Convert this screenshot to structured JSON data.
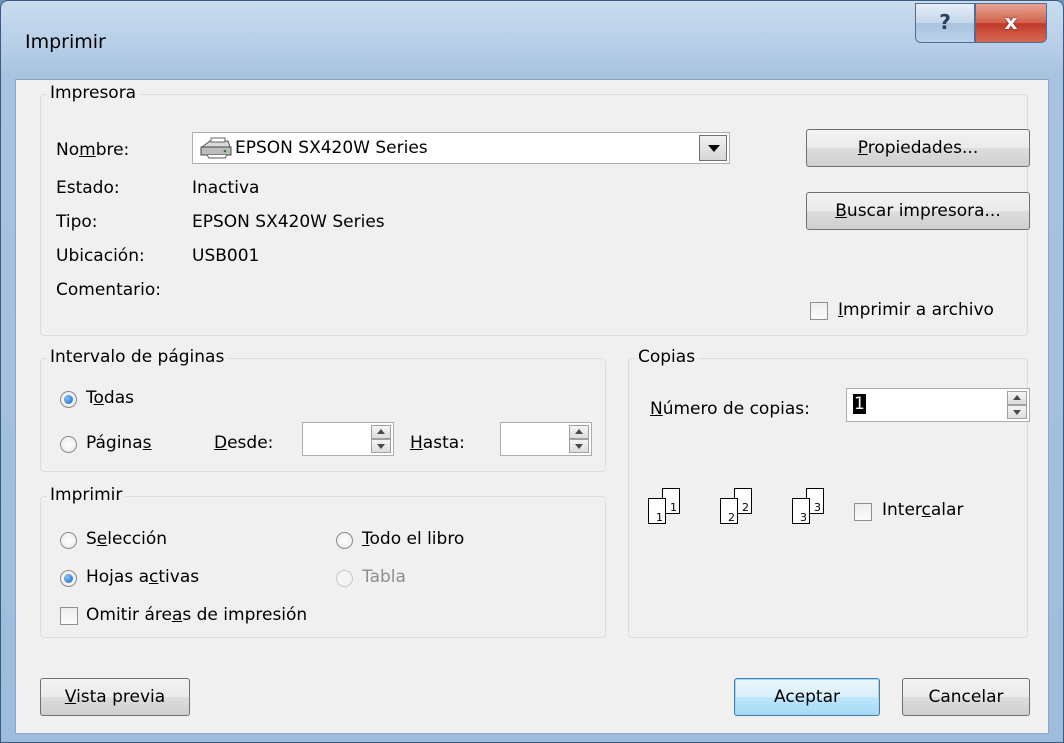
{
  "window": {
    "title": "Imprimir",
    "help_glyph": "?",
    "close_glyph": "x"
  },
  "printer": {
    "group_label": "Impresora",
    "name_label": "Nombre:",
    "name_value": "EPSON SX420W Series",
    "status_label": "Estado:",
    "status_value": "Inactiva",
    "type_label": "Tipo:",
    "type_value": "EPSON SX420W Series",
    "location_label": "Ubicación:",
    "location_value": "USB001",
    "comment_label": "Comentario:",
    "comment_value": "",
    "properties_button": "Propiedades...",
    "find_printer_button": "Buscar impresora...",
    "print_to_file_label": "Imprimir a archivo",
    "print_to_file_checked": false
  },
  "page_range": {
    "group_label": "Intervalo de páginas",
    "all_label": "Todas",
    "pages_label": "Páginas",
    "from_label": "Desde:",
    "from_value": "",
    "to_label": "Hasta:",
    "to_value": "",
    "selected": "all"
  },
  "print_what": {
    "group_label": "Imprimir",
    "selection_label": "Selección",
    "entire_workbook_label": "Todo el libro",
    "active_sheets_label": "Hojas activas",
    "table_label": "Tabla",
    "ignore_print_areas_label": "Omitir áreas de impresión",
    "selected": "active_sheets",
    "ignore_print_areas_checked": false
  },
  "copies": {
    "group_label": "Copias",
    "number_label": "Número de copias:",
    "number_value": "1",
    "collate_label": "Intercalar",
    "collate_checked": false,
    "collate_pages": [
      "1",
      "2",
      "3"
    ]
  },
  "footer": {
    "preview_button": "Vista previa",
    "ok_button": "Aceptar",
    "cancel_button": "Cancelar"
  },
  "icons": {
    "printer": "printer-icon",
    "combo_arrow": "chevron-down-icon",
    "help": "help-icon",
    "close": "close-icon"
  }
}
